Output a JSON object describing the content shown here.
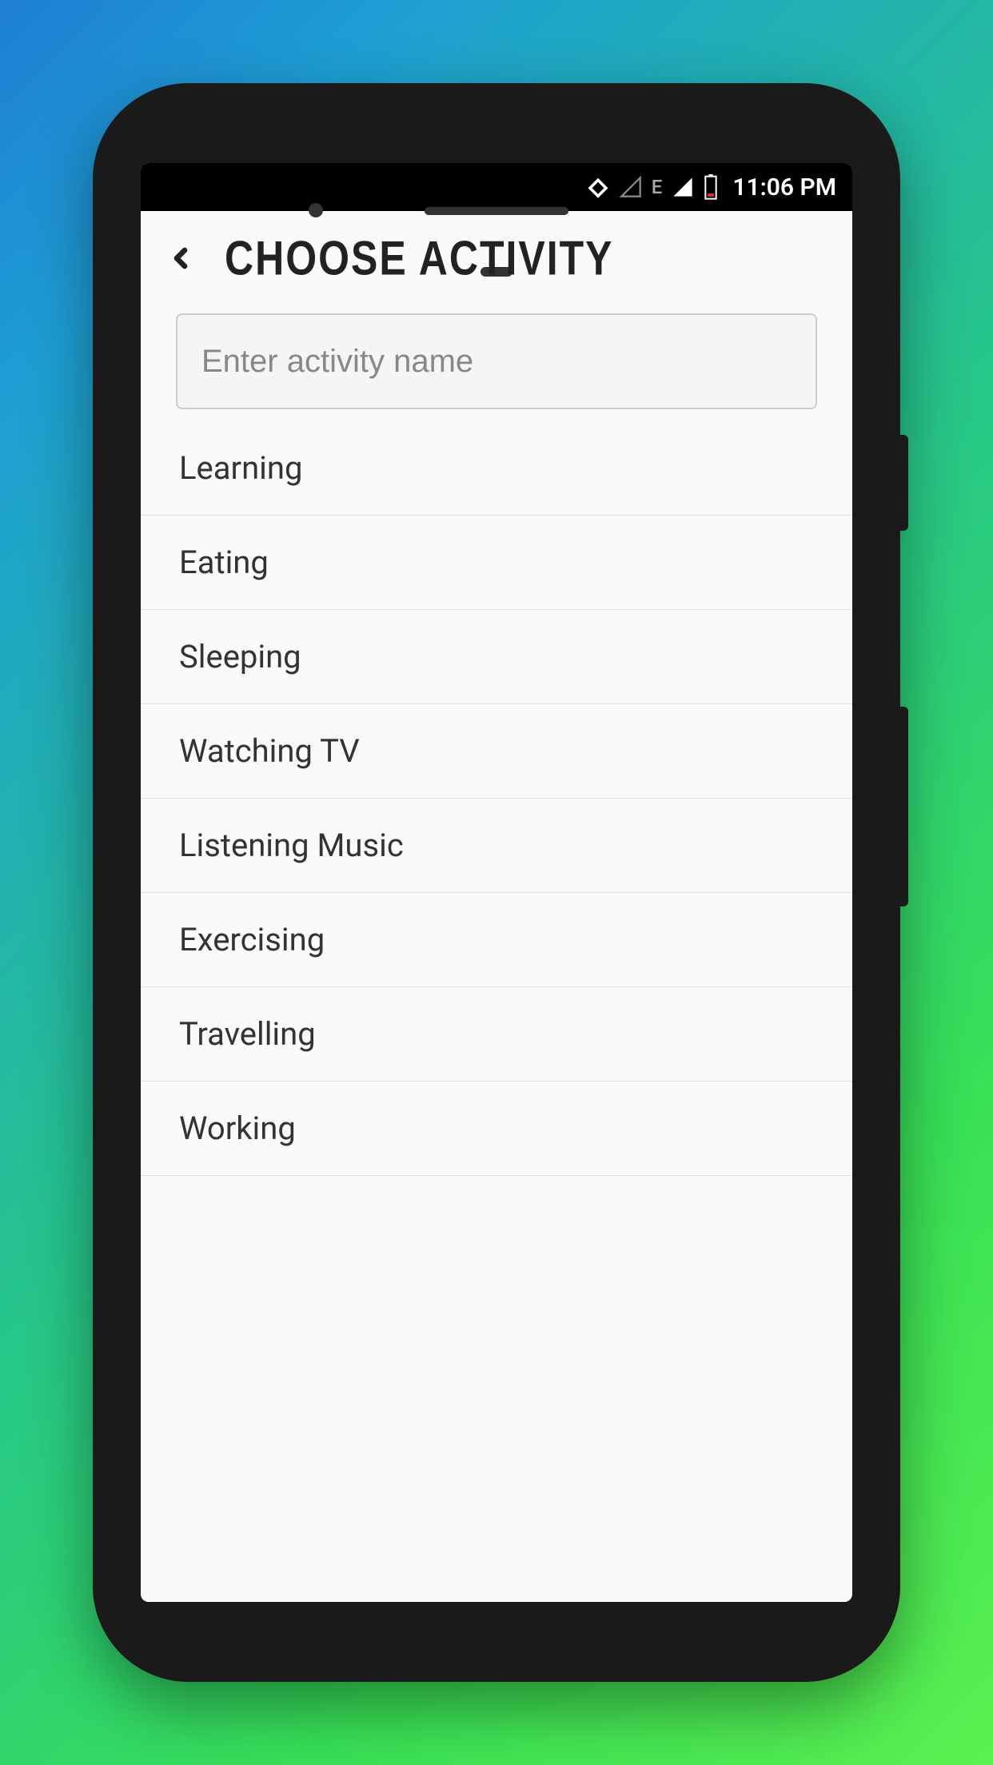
{
  "statusBar": {
    "time": "11:06 PM",
    "networkType": "E"
  },
  "header": {
    "title": "CHOOSE ACTIVITY"
  },
  "search": {
    "placeholder": "Enter activity name",
    "value": ""
  },
  "activities": [
    {
      "label": "Learning"
    },
    {
      "label": "Eating"
    },
    {
      "label": "Sleeping"
    },
    {
      "label": "Watching TV"
    },
    {
      "label": "Listening Music"
    },
    {
      "label": "Exercising"
    },
    {
      "label": "Travelling"
    },
    {
      "label": "Working"
    }
  ]
}
